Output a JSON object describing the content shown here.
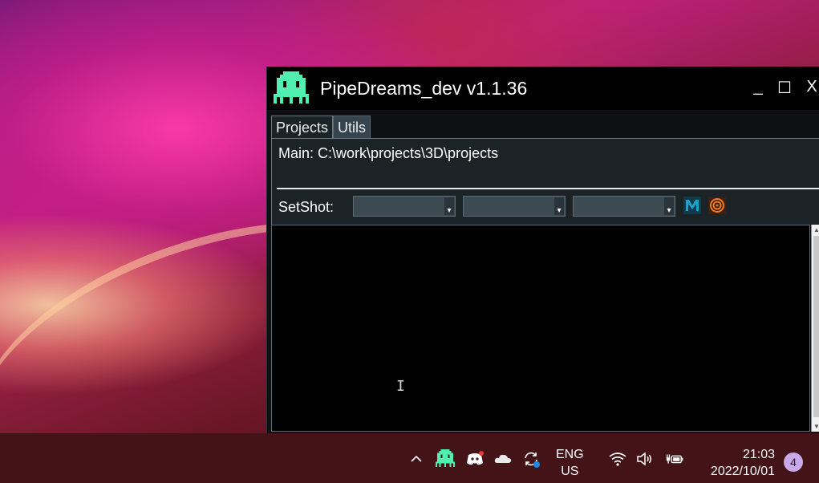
{
  "window": {
    "title": "PipeDreams_dev v1.1.36",
    "controls": {
      "minimize": "_",
      "maximize": "☐",
      "close": "X"
    }
  },
  "tabs": [
    {
      "label": "Projects",
      "active": true
    },
    {
      "label": "Utils",
      "active": false
    }
  ],
  "panel": {
    "main_path": "Main: C:\\work\\projects\\3D\\projects",
    "setshot_label": "SetShot:",
    "dropdowns": [
      "",
      "",
      ""
    ],
    "tools": [
      "maya-icon",
      "houdini-icon"
    ]
  },
  "console": {
    "cursor": "I"
  },
  "taskbar": {
    "language_line1": "ENG",
    "language_line2": "US",
    "time": "21:03",
    "date": "2022/10/01",
    "notification_count": "4",
    "tray_icons": [
      "chevron-up-icon",
      "space-invader-icon",
      "discord-icon",
      "onedrive-cloud-icon",
      "sync-icon",
      "wifi-icon",
      "volume-icon",
      "battery-charging-icon"
    ]
  },
  "colors": {
    "app_accent": "#4ff0b0",
    "maya": "#1aa3c8",
    "houdini": "#f07a20",
    "taskbar": "#431317"
  }
}
